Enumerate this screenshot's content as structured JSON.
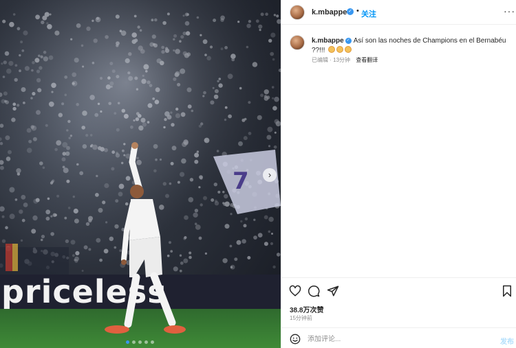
{
  "media": {
    "banner_text": "priceless",
    "flag_number": "7",
    "carousel_dots": 5,
    "active_dot_index": 0
  },
  "post": {
    "header": {
      "username": "k.mbappe",
      "separator": "•",
      "follow_label": "关注",
      "more_label": "···"
    },
    "caption": {
      "username": "k.mbappe",
      "text": "Así son las noches de Champions en el Bernabéu ??!!!",
      "edited_label": "已编辑",
      "separator": "·",
      "time_ago": "13分钟",
      "translate_label": "查看翻译"
    },
    "likes_label": "38.8万次赞",
    "posted_time": "15分钟前",
    "comment": {
      "placeholder": "添加评论...",
      "post_label": "发布"
    }
  },
  "colors": {
    "accent": "#0095f6",
    "verified": "#3897f0",
    "muted_text": "#8e8e8e"
  },
  "icons": [
    "verified-badge-icon",
    "more-options-icon",
    "heart-icon",
    "comment-icon",
    "share-icon",
    "bookmark-icon",
    "emoji-icon",
    "chevron-right-icon"
  ]
}
